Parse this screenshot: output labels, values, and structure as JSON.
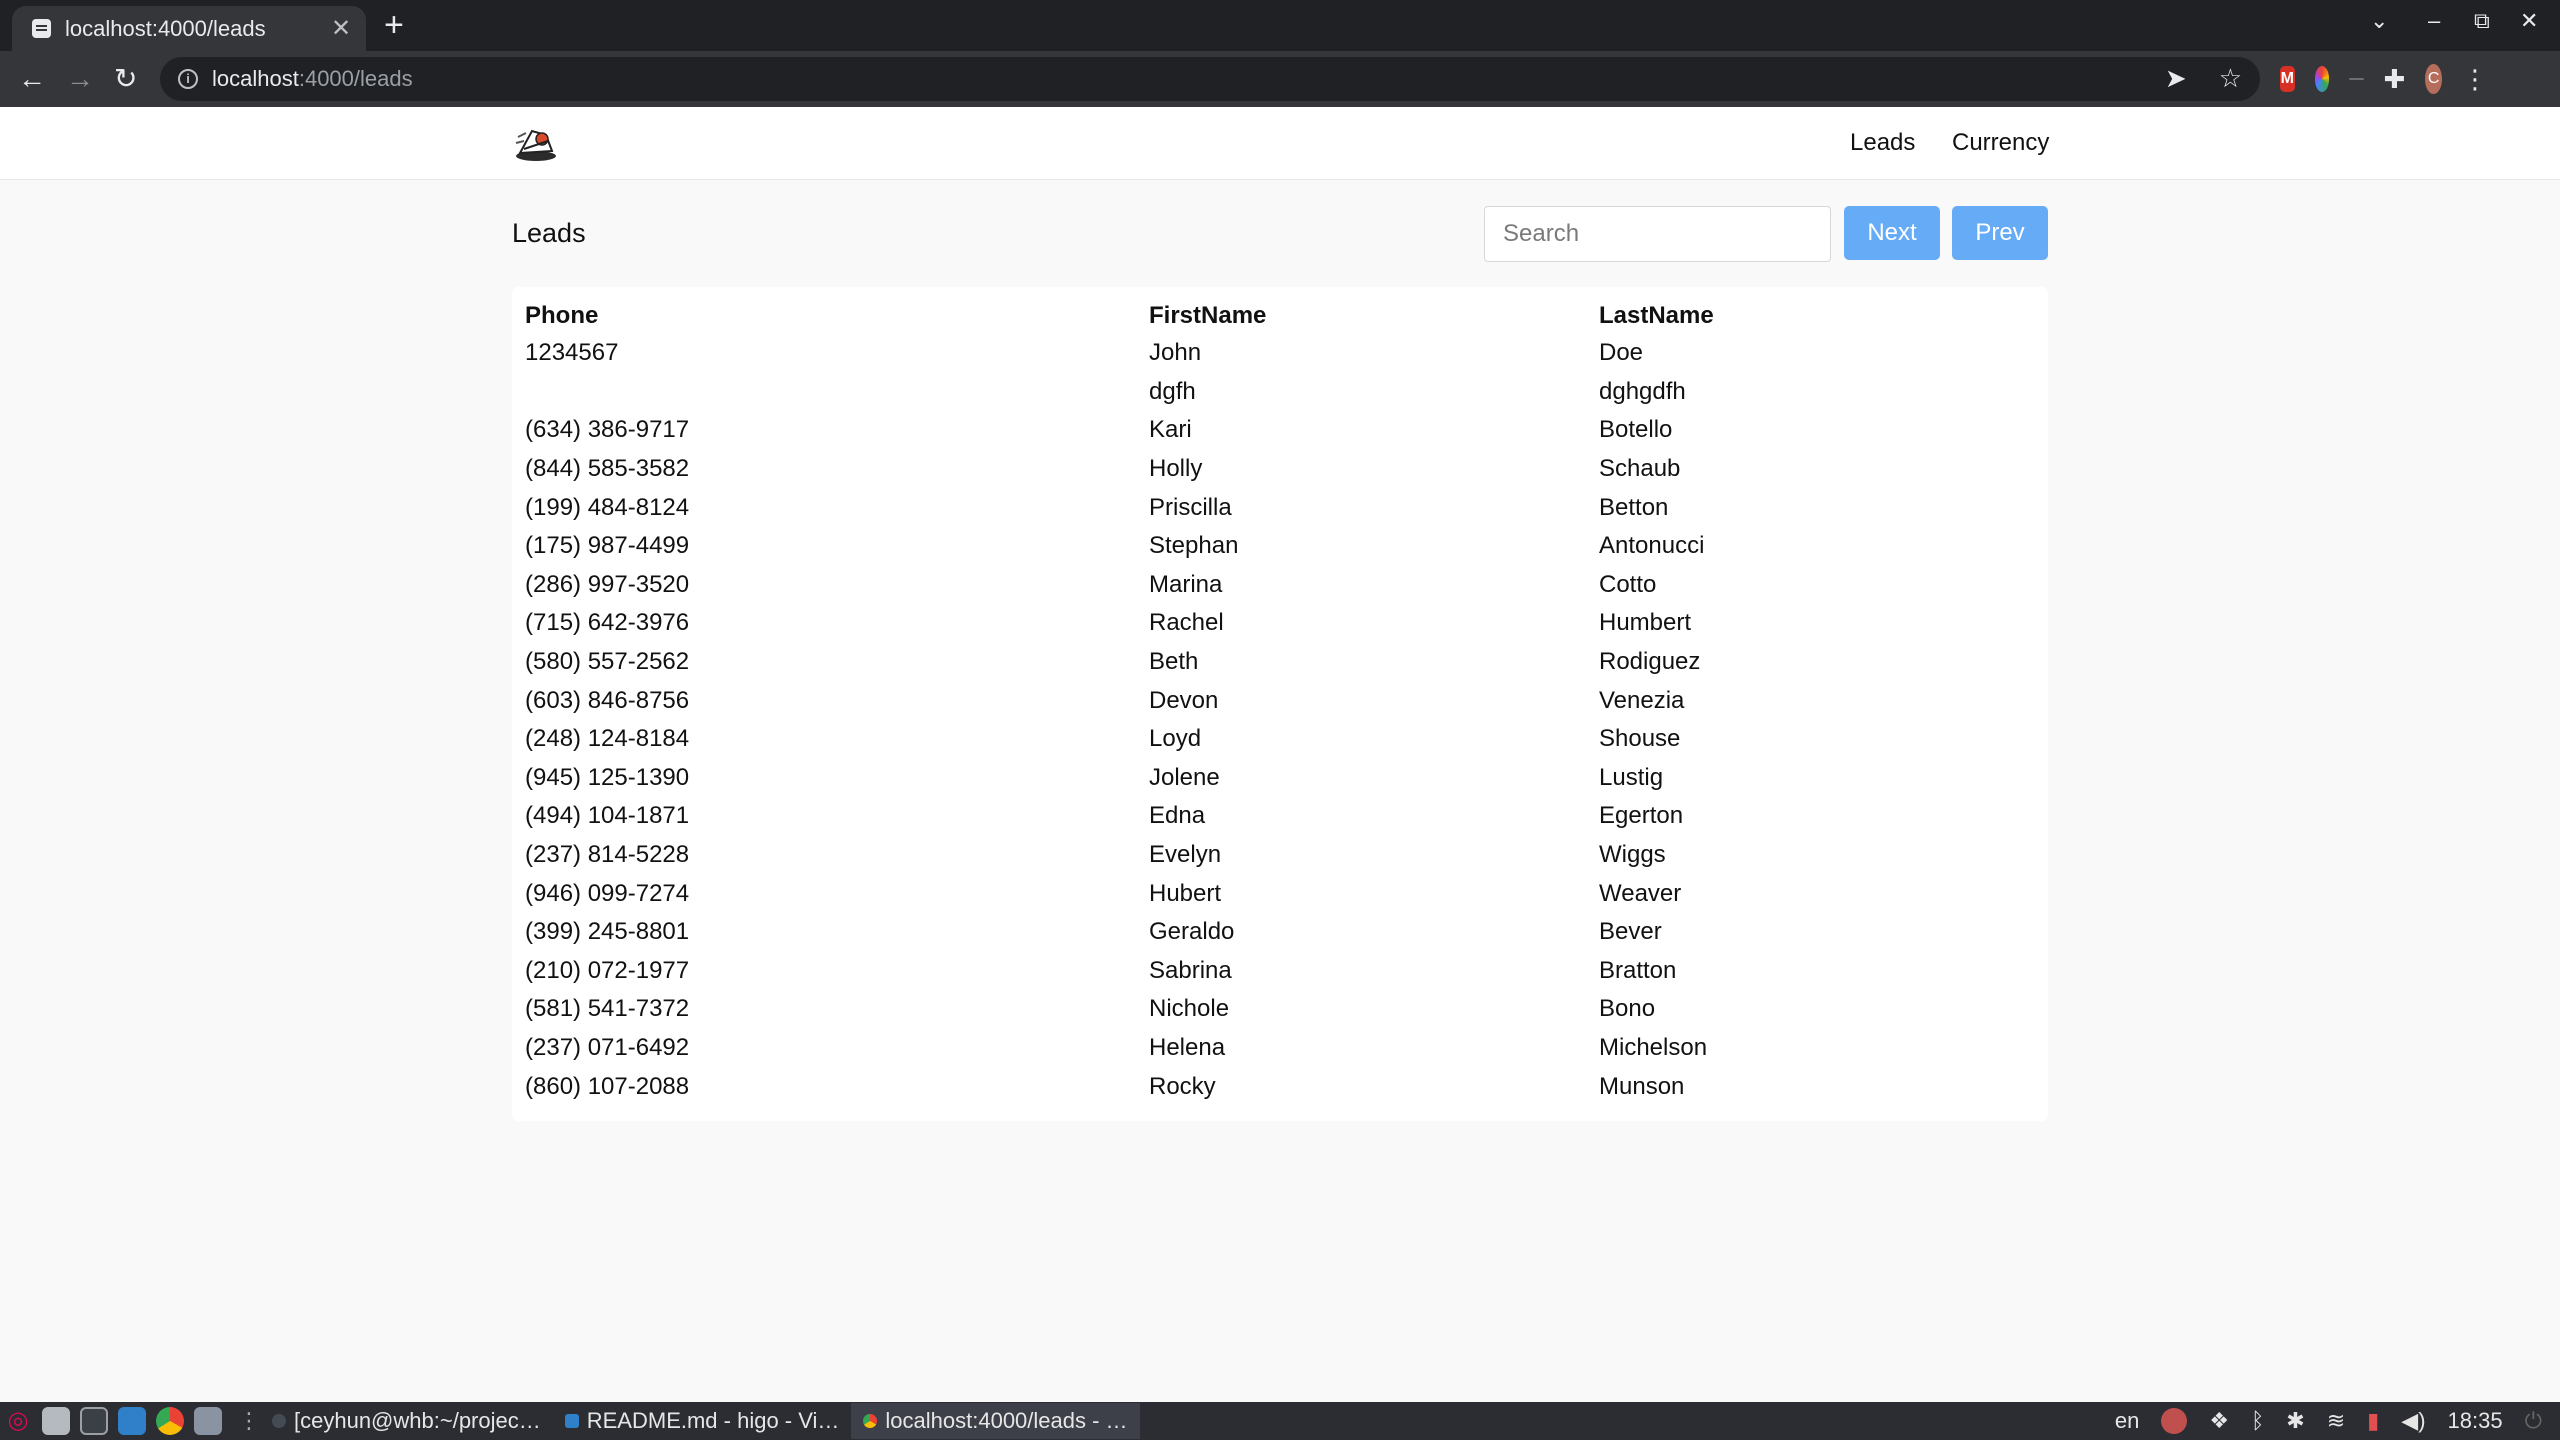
{
  "browser": {
    "tab_title": "localhost:4000/leads",
    "tab_close": "✕",
    "new_tab": "+",
    "url_host": "localhost",
    "url_path": ":4000/leads",
    "window_controls": {
      "chevron": "⌄",
      "minimize": "–",
      "restore": "⧉",
      "close": "✕"
    },
    "profile_initial": "C"
  },
  "nav": {
    "leads_label": "Leads",
    "currency_label": "Currency"
  },
  "leads": {
    "heading": "Leads",
    "search_placeholder": "Search",
    "search_value": "",
    "next_label": "Next",
    "prev_label": "Prev",
    "columns": [
      "Phone",
      "FirstName",
      "LastName"
    ],
    "rows": [
      [
        "1234567",
        "John",
        "Doe"
      ],
      [
        "",
        "dgfh",
        "dghgdfh"
      ],
      [
        "(634) 386-9717",
        "Kari",
        "Botello"
      ],
      [
        "(844) 585-3582",
        "Holly",
        "Schaub"
      ],
      [
        "(199) 484-8124",
        "Priscilla",
        "Betton"
      ],
      [
        "(175) 987-4499",
        "Stephan",
        "Antonucci"
      ],
      [
        "(286) 997-3520",
        "Marina",
        "Cotto"
      ],
      [
        "(715) 642-3976",
        "Rachel",
        "Humbert"
      ],
      [
        "(580) 557-2562",
        "Beth",
        "Rodiguez"
      ],
      [
        "(603) 846-8756",
        "Devon",
        "Venezia"
      ],
      [
        "(248) 124-8184",
        "Loyd",
        "Shouse"
      ],
      [
        "(945) 125-1390",
        "Jolene",
        "Lustig"
      ],
      [
        "(494) 104-1871",
        "Edna",
        "Egerton"
      ],
      [
        "(237) 814-5228",
        "Evelyn",
        "Wiggs"
      ],
      [
        "(946) 099-7274",
        "Hubert",
        "Weaver"
      ],
      [
        "(399) 245-8801",
        "Geraldo",
        "Bever"
      ],
      [
        "(210) 072-1977",
        "Sabrina",
        "Bratton"
      ],
      [
        "(581) 541-7372",
        "Nichole",
        "Bono"
      ],
      [
        "(237) 071-6492",
        "Helena",
        "Michelson"
      ],
      [
        "(860) 107-2088",
        "Rocky",
        "Munson"
      ]
    ]
  },
  "taskbar": {
    "tasks": [
      {
        "label": "[ceyhun@whb:~/projec…",
        "active": false
      },
      {
        "label": "README.md - higo - Vi…",
        "active": false
      },
      {
        "label": "localhost:4000/leads - …",
        "active": true
      }
    ],
    "keyboard_layout": "en",
    "clock": "18:35"
  },
  "colors": {
    "button_primary": "#66abf5",
    "chrome_dark": "#202124",
    "chrome_toolbar": "#35363a",
    "taskbar": "#2b2d33"
  }
}
